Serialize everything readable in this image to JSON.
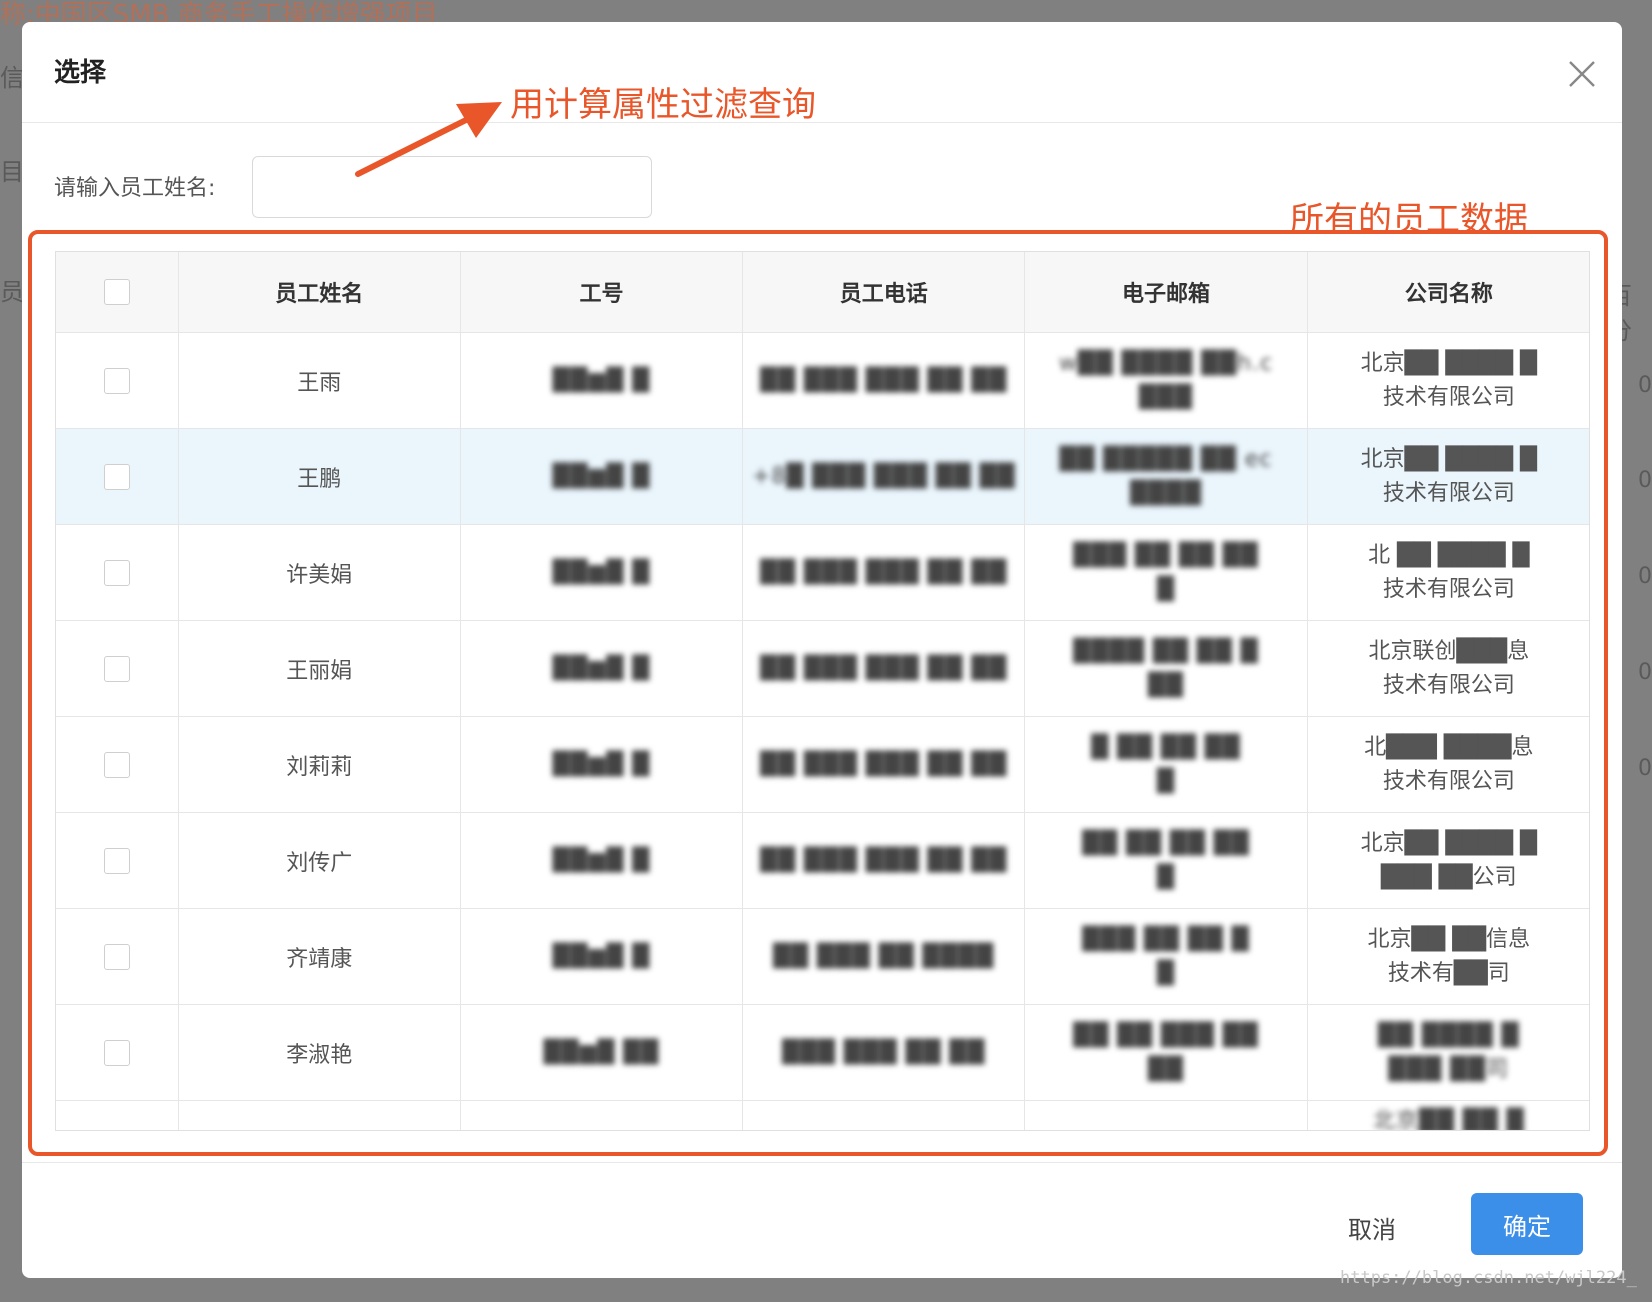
{
  "background": {
    "project_title": "称:中国区SMB 商务手工操作增强项目",
    "fragments": [
      "信",
      "目",
      "员",
      "百分"
    ],
    "numbers": [
      "0",
      "0",
      "0",
      "0",
      "0"
    ]
  },
  "dialog": {
    "title": "选择",
    "filter_label": "请输入员工姓名:",
    "search_value": "",
    "cancel_label": "取消",
    "ok_label": "确定"
  },
  "annotations": {
    "filter_note": "用计算属性过滤查询",
    "table_note": "所有的员工数据"
  },
  "table": {
    "columns": [
      "员工姓名",
      "工号",
      "员工电话",
      "电子邮箱",
      "公司名称"
    ],
    "rows": [
      {
        "name": "王雨",
        "id": "██▆█ █",
        "phone": "██ ███ ███ ██ ██",
        "email": [
          "w██ ████ ██h.c",
          "███"
        ],
        "company": [
          "北京██ ████ █",
          "技术有限公司"
        ]
      },
      {
        "name": "王鹏",
        "id": "██▆█ █",
        "phone": "+8█ ███ ███ ██ ██",
        "email": [
          "██ █████ ██ ec",
          "████"
        ],
        "company": [
          "北京██ ████ █",
          "技术有限公司"
        ]
      },
      {
        "name": "许美娟",
        "id": "██▆█ █",
        "phone": "██ ███ ███ ██ ██",
        "email": [
          "███ ██ ██ ██",
          "█"
        ],
        "company": [
          "北 ██ ████ █",
          "技术有限公司"
        ]
      },
      {
        "name": "王丽娟",
        "id": "██▆█ █",
        "phone": "██ ███ ███ ██ ██",
        "email": [
          "████ ██ ██ █",
          "██"
        ],
        "company": [
          "北京联创███息",
          "技术有限公司"
        ]
      },
      {
        "name": "刘莉莉",
        "id": "██▆█ █",
        "phone": "██ ███ ███ ██ ██",
        "email": [
          "█ ██ ██ ██",
          "█"
        ],
        "company": [
          "北███ ████息",
          "技术有限公司"
        ]
      },
      {
        "name": "刘传广",
        "id": "██▆█ █",
        "phone": "██ ███ ███ ██ ██",
        "email": [
          "██ ██ ██ ██",
          "█"
        ],
        "company": [
          "北京██ ████ █",
          "███ ██公司"
        ]
      },
      {
        "name": "齐靖康",
        "id": "██▆█ █",
        "phone": "██ ███ ██ ████",
        "email": [
          "███ ██ ██ █",
          "█"
        ],
        "company": [
          "北京██ ██信息",
          "技术有██司"
        ]
      },
      {
        "name": "李淑艳",
        "id": "██▆█ ██",
        "phone": "███ ███ ██ ██",
        "email": [
          "██ ██ ███ ██",
          "██"
        ],
        "company": [
          "██ ████ █",
          "███ ██司"
        ]
      },
      {
        "name": "",
        "id": "",
        "phone": "",
        "email": [
          "",
          ""
        ],
        "company": [
          "北京██ ██ █",
          ""
        ]
      }
    ]
  },
  "watermark": "https://blog.csdn.net/wjl224_",
  "colors": {
    "annotation": "#e8562a",
    "primary": "#3c8fe8",
    "hover_row": "#eaf5fc"
  }
}
